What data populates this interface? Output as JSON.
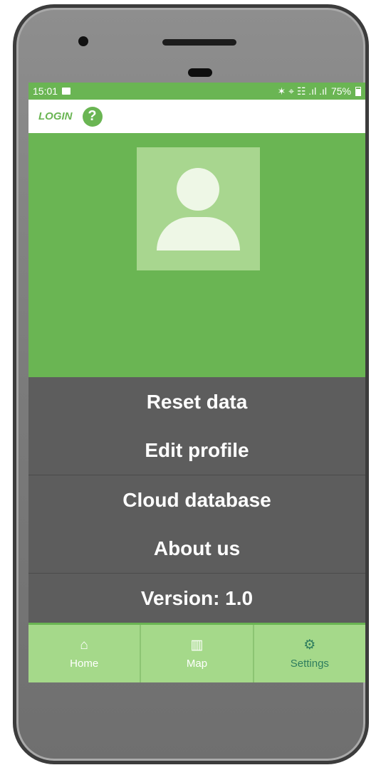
{
  "status_bar": {
    "time": "15:01",
    "indicators": "✶ ⌖ ☷ .ıl .ıl",
    "battery": "75%"
  },
  "app_bar": {
    "login_label": "LOGIN",
    "help_glyph": "?"
  },
  "menu": {
    "items": [
      {
        "label": "Reset data"
      },
      {
        "label": "Edit profile"
      },
      {
        "label": "Cloud database"
      },
      {
        "label": "About us"
      },
      {
        "label": "Version: 1.0"
      }
    ]
  },
  "bottom_nav": {
    "items": [
      {
        "label": "Home",
        "icon": "home-icon",
        "glyph": "⌂"
      },
      {
        "label": "Map",
        "icon": "map-icon",
        "glyph": "▥"
      },
      {
        "label": "Settings",
        "icon": "gear-icon",
        "glyph": "⚙"
      }
    ],
    "active": "Settings"
  },
  "colors": {
    "primary_green": "#6ab553",
    "nav_green": "#a5d98a",
    "menu_gray": "#5d5d5d",
    "active_tab": "#2e7d5e"
  }
}
